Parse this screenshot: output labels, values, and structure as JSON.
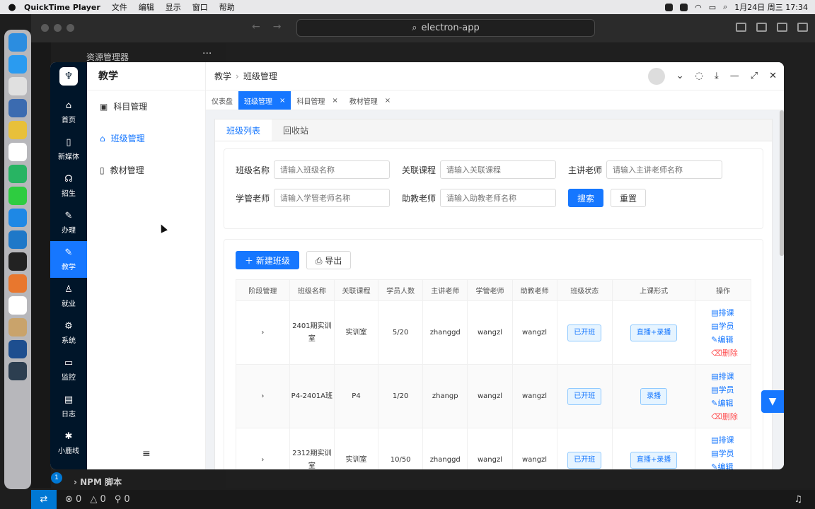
{
  "menubar": {
    "apple": "",
    "app": "QuickTime Player",
    "items": [
      "文件",
      "编辑",
      "显示",
      "窗口",
      "帮助"
    ],
    "datetime": "1月24日 周三  17:34"
  },
  "vscode": {
    "command_center": "electron-app",
    "explorer_title": "资源管理器",
    "more": "···",
    "npm_scripts": "NPM 脚本",
    "status": {
      "errors": "0",
      "warnings": "0",
      "ports": "0"
    },
    "badge": "1"
  },
  "app": {
    "logo": "♆",
    "nav": [
      {
        "icon": "⌂",
        "label": "首页"
      },
      {
        "icon": "▯",
        "label": "新媒体"
      },
      {
        "icon": "☊",
        "label": "招生"
      },
      {
        "icon": "✎",
        "label": "办理"
      },
      {
        "icon": "✎",
        "label": "教学"
      },
      {
        "icon": "♙",
        "label": "就业"
      },
      {
        "icon": "⚙",
        "label": "系统"
      },
      {
        "icon": "▭",
        "label": "监控"
      },
      {
        "icon": "▤",
        "label": "日志"
      },
      {
        "icon": "✱",
        "label": "小鹿线"
      }
    ],
    "submenu": {
      "title": "教学",
      "items": [
        {
          "icon": "▣",
          "label": "科目管理"
        },
        {
          "icon": "⌂",
          "label": "班级管理"
        },
        {
          "icon": "▯",
          "label": "教材管理"
        }
      ],
      "collapse": "≡"
    },
    "breadcrumb": {
      "root": "教学",
      "sep": "›",
      "current": "班级管理"
    },
    "tabs": [
      {
        "label": "仪表盘",
        "close": ""
      },
      {
        "label": "班级管理",
        "close": "×"
      },
      {
        "label": "科目管理",
        "close": "×"
      },
      {
        "label": "教材管理",
        "close": "×"
      }
    ],
    "card_tabs": [
      "班级列表",
      "回收站"
    ],
    "search": {
      "fields": [
        {
          "label": "班级名称",
          "placeholder": "请输入班级名称"
        },
        {
          "label": "关联课程",
          "placeholder": "请输入关联课程"
        },
        {
          "label": "主讲老师",
          "placeholder": "请输入主讲老师名称"
        },
        {
          "label": "学管老师",
          "placeholder": "请输入学管老师名称"
        },
        {
          "label": "助教老师",
          "placeholder": "请输入助教老师名称"
        }
      ],
      "search_btn": "搜索",
      "reset_btn": "重置"
    },
    "toolbar": {
      "new": "＋ 新建班级",
      "export": "⎙ 导出"
    },
    "table": {
      "headers": [
        "阶段管理",
        "班级名称",
        "关联课程",
        "学员人数",
        "主讲老师",
        "学管老师",
        "助教老师",
        "班级状态",
        "上课形式",
        "操作"
      ],
      "rows": [
        {
          "expand": "›",
          "name": "2401期实训室",
          "course": "实训室",
          "count": "5/20",
          "lecturer": "zhanggd",
          "manager": "wangzl",
          "assistant": "wangzl",
          "status": "已开班",
          "mode": "直播+录播"
        },
        {
          "expand": "›",
          "name": "P4-2401A班",
          "course": "P4",
          "count": "1/20",
          "lecturer": "zhangp",
          "manager": "wangzl",
          "assistant": "wangzl",
          "status": "已开班",
          "mode": "录播"
        },
        {
          "expand": "›",
          "name": "2312期实训室",
          "course": "实训室",
          "count": "10/50",
          "lecturer": "zhanggd",
          "manager": "wangzl",
          "assistant": "wangzl",
          "status": "已开班",
          "mode": "直播+录播"
        }
      ],
      "ops": {
        "schedule": "▤排课",
        "students": "▤学员",
        "edit": "✎编辑",
        "delete": "⌫删除"
      }
    }
  }
}
